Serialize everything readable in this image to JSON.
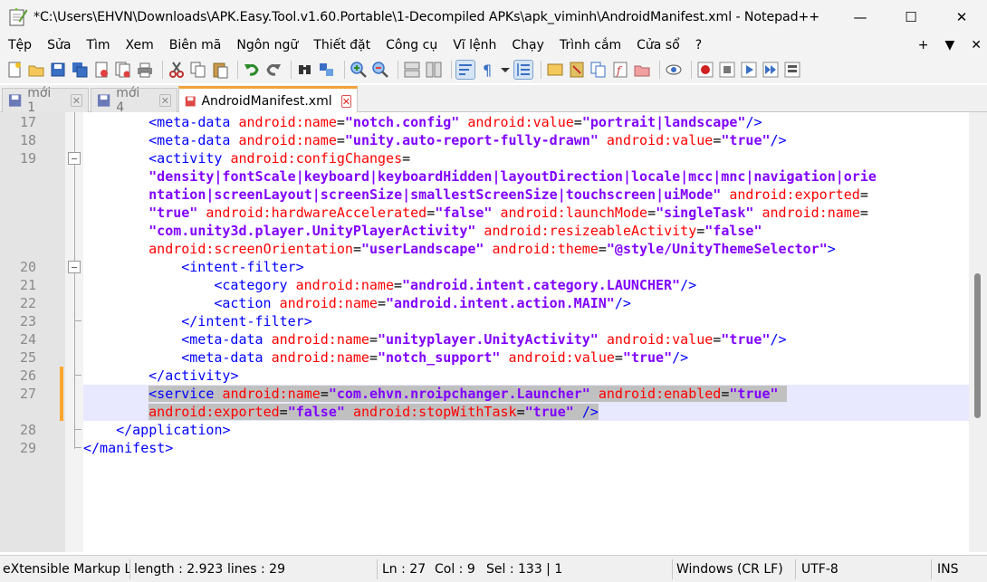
{
  "window": {
    "title": "*C:\\Users\\EHVN\\Downloads\\APK.Easy.Tool.v1.60.Portable\\1-Decompiled APKs\\apk_viminh\\AndroidManifest.xml - Notepad++",
    "minimize_glyph": "—",
    "maximize_glyph": "☐",
    "close_glyph": "✕"
  },
  "menu": {
    "items": [
      "Tệp",
      "Sửa",
      "Tìm",
      "Xem",
      "Biên mã",
      "Ngôn ngữ",
      "Thiết đặt",
      "Công cụ",
      "Vĩ lệnh",
      "Chạy",
      "Trình cắm",
      "Cửa sổ",
      "?"
    ],
    "right": [
      "+",
      "▼",
      "✕"
    ]
  },
  "tabs": [
    {
      "label": "mới 1",
      "close": "✕"
    },
    {
      "label": "mới 4",
      "close": "✕"
    },
    {
      "label": "AndroidManifest.xml",
      "close": "✕"
    }
  ],
  "colors": {
    "tag": "#0000ff",
    "attr": "#ff0000",
    "value": "#8000ff",
    "current_line": "#e8e8ff",
    "selection": "#c0c0c0",
    "active_tab_accent": "#f2a23a"
  },
  "editor": {
    "line_numbers": [
      "17",
      "18",
      "19",
      "20",
      "21",
      "22",
      "23",
      "24",
      "25",
      "26",
      "27",
      "28",
      "29"
    ],
    "lines": [
      [
        [
          "t",
          "<meta-data "
        ],
        [
          "a",
          "android:name"
        ],
        [
          "e",
          "="
        ],
        [
          "v",
          "\"notch.config\""
        ],
        [
          "e",
          " "
        ],
        [
          "a",
          "android:value"
        ],
        [
          "e",
          "="
        ],
        [
          "v",
          "\"portrait|landscape\""
        ],
        [
          "t",
          "/>"
        ]
      ],
      [
        [
          "t",
          "<meta-data "
        ],
        [
          "a",
          "android:name"
        ],
        [
          "e",
          "="
        ],
        [
          "v",
          "\"unity.auto-report-fully-drawn\""
        ],
        [
          "e",
          " "
        ],
        [
          "a",
          "android:value"
        ],
        [
          "e",
          "="
        ],
        [
          "v",
          "\"true\""
        ],
        [
          "t",
          "/>"
        ]
      ],
      [
        [
          "t",
          "<activity "
        ],
        [
          "a",
          "android:configChanges"
        ],
        [
          "e",
          "="
        ]
      ],
      [
        [
          "v",
          "\"density|fontScale|keyboard|keyboardHidden|layoutDirection|locale|mcc|mnc|navigation|orie"
        ]
      ],
      [
        [
          "v",
          "ntation|screenLayout|screenSize|smallestScreenSize|touchscreen|uiMode\""
        ],
        [
          "e",
          " "
        ],
        [
          "a",
          "android:exported"
        ],
        [
          "e",
          "="
        ]
      ],
      [
        [
          "v",
          "\"true\""
        ],
        [
          "e",
          " "
        ],
        [
          "a",
          "android:hardwareAccelerated"
        ],
        [
          "e",
          "="
        ],
        [
          "v",
          "\"false\""
        ],
        [
          "e",
          " "
        ],
        [
          "a",
          "android:launchMode"
        ],
        [
          "e",
          "="
        ],
        [
          "v",
          "\"singleTask\""
        ],
        [
          "e",
          " "
        ],
        [
          "a",
          "android:name"
        ],
        [
          "e",
          "="
        ]
      ],
      [
        [
          "v",
          "\"com.unity3d.player.UnityPlayerActivity\""
        ],
        [
          "e",
          " "
        ],
        [
          "a",
          "android:resizeableActivity"
        ],
        [
          "e",
          "="
        ],
        [
          "v",
          "\"false\""
        ]
      ],
      [
        [
          "a",
          "android:screenOrientation"
        ],
        [
          "e",
          "="
        ],
        [
          "v",
          "\"userLandscape\""
        ],
        [
          "e",
          " "
        ],
        [
          "a",
          "android:theme"
        ],
        [
          "e",
          "="
        ],
        [
          "v",
          "\"@style/UnityThemeSelector\""
        ],
        [
          "t",
          ">"
        ]
      ],
      [
        [
          "t",
          "<intent-filter>"
        ]
      ],
      [
        [
          "t",
          "<category "
        ],
        [
          "a",
          "android:name"
        ],
        [
          "e",
          "="
        ],
        [
          "v",
          "\"android.intent.category.LAUNCHER\""
        ],
        [
          "t",
          "/>"
        ]
      ],
      [
        [
          "t",
          "<action "
        ],
        [
          "a",
          "android:name"
        ],
        [
          "e",
          "="
        ],
        [
          "v",
          "\"android.intent.action.MAIN\""
        ],
        [
          "t",
          "/>"
        ]
      ],
      [
        [
          "t",
          "</intent-filter>"
        ]
      ],
      [
        [
          "t",
          "<meta-data "
        ],
        [
          "a",
          "android:name"
        ],
        [
          "e",
          "="
        ],
        [
          "v",
          "\"unityplayer.UnityActivity\""
        ],
        [
          "e",
          " "
        ],
        [
          "a",
          "android:value"
        ],
        [
          "e",
          "="
        ],
        [
          "v",
          "\"true\""
        ],
        [
          "t",
          "/>"
        ]
      ],
      [
        [
          "t",
          "<meta-data "
        ],
        [
          "a",
          "android:name"
        ],
        [
          "e",
          "="
        ],
        [
          "v",
          "\"notch_support\""
        ],
        [
          "e",
          " "
        ],
        [
          "a",
          "android:value"
        ],
        [
          "e",
          "="
        ],
        [
          "v",
          "\"true\""
        ],
        [
          "t",
          "/>"
        ]
      ],
      [
        [
          "t",
          "</activity>"
        ]
      ],
      [
        [
          "t",
          "<service "
        ],
        [
          "a",
          "android:name"
        ],
        [
          "e",
          "="
        ],
        [
          "v",
          "\"com.ehvn.nroipchanger.Launcher\""
        ],
        [
          "e",
          " "
        ],
        [
          "a",
          "android:enabled"
        ],
        [
          "e",
          "="
        ],
        [
          "v",
          "\"true\""
        ],
        [
          "e",
          " "
        ]
      ],
      [
        [
          "a",
          "android:exported"
        ],
        [
          "e",
          "="
        ],
        [
          "v",
          "\"false\""
        ],
        [
          "e",
          " "
        ],
        [
          "a",
          "android:stopWithTask"
        ],
        [
          "e",
          "="
        ],
        [
          "v",
          "\"true\""
        ],
        [
          "e",
          " "
        ],
        [
          "t",
          "/>"
        ]
      ],
      [
        [
          "t",
          "</application>"
        ]
      ],
      [
        [
          "t",
          "</manifest>"
        ]
      ]
    ]
  },
  "status": {
    "lang": "eXtensible Markup La",
    "length": "length : 2.923",
    "lines": "lines : 29",
    "ln": "Ln : 27",
    "col": "Col : 9",
    "sel": "Sel : 133 | 1",
    "eol": "Windows (CR LF)",
    "encoding": "UTF-8",
    "mode": "INS"
  }
}
